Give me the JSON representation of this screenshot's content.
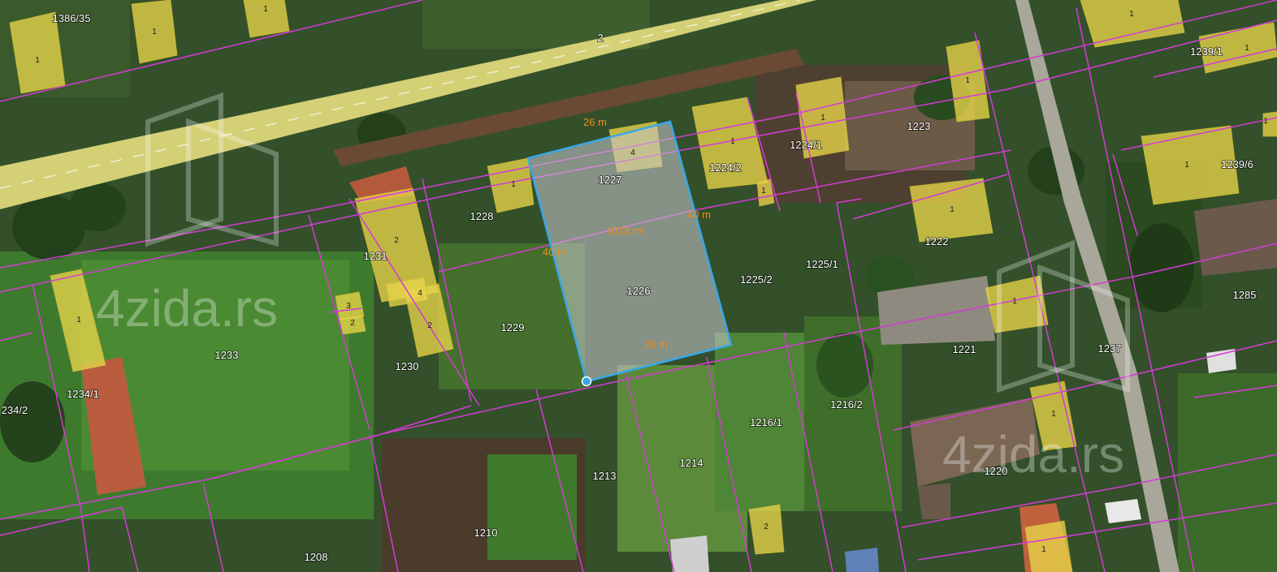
{
  "watermark": {
    "text": "4zida.rs"
  },
  "parcels": [
    "1386/35",
    "2",
    "1239/1",
    "1227",
    "1228",
    "1224/2",
    "1224/1",
    "1223",
    "1231",
    "1222",
    "1225/1",
    "1225/2",
    "1226",
    "1229",
    "1233",
    "1230",
    "1221",
    "1237",
    "1285",
    "1239/6",
    "1234/1",
    "234/2",
    "1216/2",
    "1216/1",
    "1220",
    "1213",
    "1214",
    "1210",
    "1208"
  ],
  "buildings": [
    "1",
    "1",
    "1",
    "1",
    "1",
    "4",
    "1",
    "1",
    "1",
    "1",
    "1",
    "2",
    "1",
    "2",
    "1",
    "1",
    "4",
    "3",
    "2",
    "1",
    "1",
    "1",
    "1",
    "2"
  ],
  "measurements": {
    "north": "26 m",
    "east": "40 m",
    "west": "40 m",
    "south": "26 m",
    "area": "1023 m²"
  },
  "colors": {
    "parcel_line": "#d53ad6",
    "building_fill": "#e8d54a",
    "road_fill": "#ddd77a",
    "selection": "#3aa7e6",
    "measure_text": "#f28a1c"
  }
}
